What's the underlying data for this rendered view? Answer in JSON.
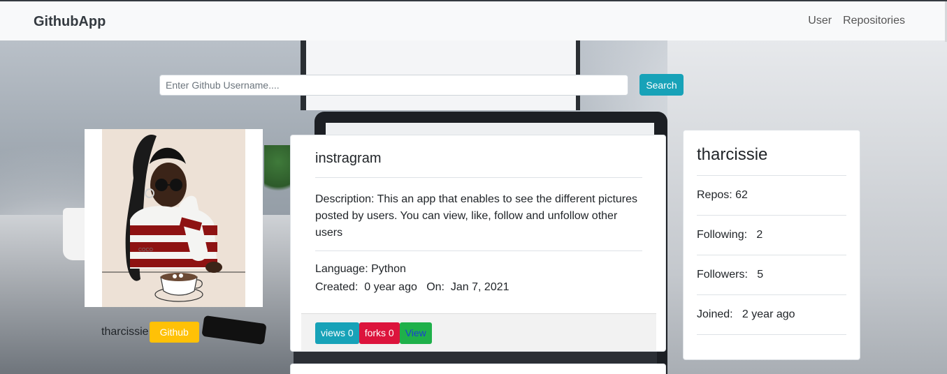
{
  "navbar": {
    "brand": "GithubApp",
    "links": [
      "User",
      "Repositories"
    ]
  },
  "search": {
    "placeholder": "Enter Github Username....",
    "button_label": "Search"
  },
  "profile": {
    "name": "tharcissie",
    "github_label": "Github",
    "avatar_text": "COCO"
  },
  "repo": {
    "title": "instragram",
    "description": "Description:  This an app that enables to see the different pictures posted by users. You can view, like, follow and unfollow other users",
    "language": "Language: Python",
    "created": "Created:  0 year ago   On:  Jan 7, 2021",
    "views_label": "views 0",
    "forks_label": "forks 0",
    "view_label": "View"
  },
  "stats": {
    "username": "tharcissie",
    "repos": "Repos:  62",
    "following": "Following:   2",
    "followers": "Followers:   5",
    "joined": "Joined:   2 year ago"
  },
  "colors": {
    "search_button": "#17a2b8",
    "github_badge": "#ffc107",
    "views_badge": "#17a2b8",
    "forks_badge": "#dc143c",
    "view_badge": "#1fb04a"
  }
}
